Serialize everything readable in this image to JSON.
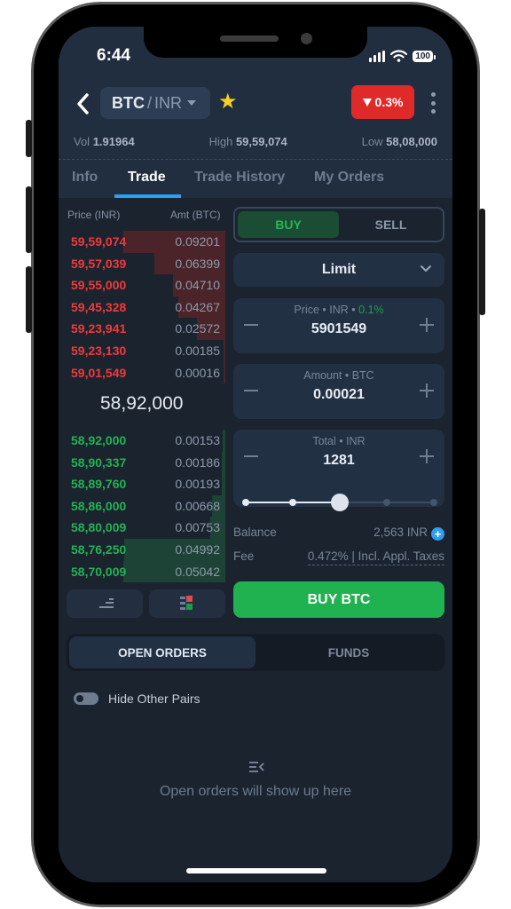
{
  "status_bar": {
    "time": "6:44",
    "battery": "100"
  },
  "header": {
    "pair_base": "BTC",
    "pair_separator": "/",
    "pair_quote": "INR",
    "change_badge": "0.3%",
    "change_direction": "down",
    "favorite": true
  },
  "stats": {
    "vol_label": "Vol",
    "vol_value": "1.91964",
    "high_label": "High",
    "high_value": "59,59,074",
    "low_label": "Low",
    "low_value": "58,08,000"
  },
  "tabs": [
    {
      "label": "Info",
      "active": false
    },
    {
      "label": "Trade",
      "active": true
    },
    {
      "label": "Trade History",
      "active": false
    },
    {
      "label": "My Orders",
      "active": false
    }
  ],
  "orderbook": {
    "price_header": "Price (INR)",
    "amount_header": "Amt (BTC)",
    "asks": [
      {
        "price": "59,59,074",
        "amount": "0.09201"
      },
      {
        "price": "59,57,039",
        "amount": "0.06399"
      },
      {
        "price": "59,55,000",
        "amount": "0.04710"
      },
      {
        "price": "59,45,328",
        "amount": "0.04267"
      },
      {
        "price": "59,23,941",
        "amount": "0.02572"
      },
      {
        "price": "59,23,130",
        "amount": "0.00185"
      },
      {
        "price": "59,01,549",
        "amount": "0.00016"
      }
    ],
    "last_price": "58,92,000",
    "bids": [
      {
        "price": "58,92,000",
        "amount": "0.00153"
      },
      {
        "price": "58,90,337",
        "amount": "0.00186"
      },
      {
        "price": "58,89,760",
        "amount": "0.00193"
      },
      {
        "price": "58,86,000",
        "amount": "0.00668"
      },
      {
        "price": "58,80,009",
        "amount": "0.00753"
      },
      {
        "price": "58,76,250",
        "amount": "0.04992"
      },
      {
        "price": "58,70,009",
        "amount": "0.05042"
      }
    ]
  },
  "trade_form": {
    "buy_label": "BUY",
    "sell_label": "SELL",
    "active_side": "buy",
    "order_type": "Limit",
    "price": {
      "label": "Price • INR • ",
      "pct": "0.1%",
      "value": "5901549"
    },
    "amount": {
      "label": "Amount • BTC",
      "value": "0.00021"
    },
    "total": {
      "label": "Total • INR",
      "value": "1281"
    },
    "slider_percent": 50,
    "slider_steps": [
      0,
      25,
      50,
      75,
      100
    ],
    "balance_label": "Balance",
    "balance_value": "2,563 INR",
    "fee_label": "Fee",
    "fee_value": "0.472% | Incl. Appl. Taxes",
    "submit_label": "BUY BTC"
  },
  "orders": {
    "tabs": [
      {
        "label": "OPEN ORDERS",
        "active": true
      },
      {
        "label": "FUNDS",
        "active": false
      }
    ],
    "hide_other_pairs_label": "Hide Other Pairs",
    "hide_other_pairs": false,
    "empty_text": "Open orders will show up here"
  },
  "colors": {
    "ask": "#ee3b3b",
    "bid": "#22b254",
    "accent": "#2d9ef0",
    "buy_button": "#20b150",
    "change_badge": "#e02a2a"
  }
}
